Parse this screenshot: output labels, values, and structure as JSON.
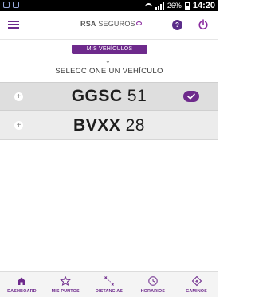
{
  "status_bar": {
    "battery_pct": "26%",
    "time": "14:20"
  },
  "header": {
    "logo_brand": "RSA",
    "logo_text": "SEGUROS",
    "help_label": "?",
    "accent_color": "#6e2a8c"
  },
  "section": {
    "tab_label": "MIS VEHÍCULOS",
    "title": "SELECCIONE UN VEHÍCULO"
  },
  "vehicles": [
    {
      "plate_letters": "GGSC",
      "plate_digits": "51",
      "selected": true,
      "expand_symbol": "+"
    },
    {
      "plate_letters": "BVXX",
      "plate_digits": "28",
      "selected": false,
      "expand_symbol": "+"
    }
  ],
  "bottom_nav": [
    {
      "label": "DASHBOARD",
      "icon": "home-icon"
    },
    {
      "label": "MIS PUNTOS",
      "icon": "star-icon"
    },
    {
      "label": "DISTANCIAS",
      "icon": "distance-icon"
    },
    {
      "label": "HORARIOS",
      "icon": "clock-icon"
    },
    {
      "label": "CAMINOS",
      "icon": "road-icon"
    }
  ]
}
